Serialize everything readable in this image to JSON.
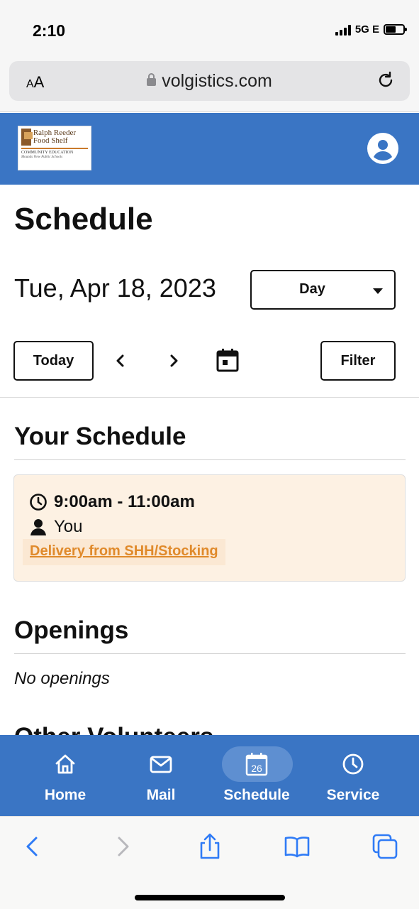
{
  "status_bar": {
    "time": "2:10",
    "network": "5G E",
    "battery_level": 0.6
  },
  "browser": {
    "text_size_small": "A",
    "text_size_large": "A",
    "url": "volgistics.com"
  },
  "header": {
    "logo_text": "Ralph Reeder Food Shelf",
    "logo_sub": "COMMUNITY EDUCATION",
    "logo_sub2": "Mounds View Public Schools"
  },
  "page": {
    "title": "Schedule",
    "date": "Tue, Apr 18, 2023",
    "view_select": "Day",
    "today_label": "Today",
    "filter_label": "Filter"
  },
  "your_schedule": {
    "title": "Your Schedule",
    "time": "9:00am - 11:00am",
    "who": "You",
    "task": "Delivery from SHH/Stocking"
  },
  "openings": {
    "title": "Openings",
    "empty_text": "No openings"
  },
  "other_volunteers": {
    "title": "Other Volunteers"
  },
  "bottom_nav": {
    "items": [
      {
        "label": "Home",
        "icon": "home-icon"
      },
      {
        "label": "Mail",
        "icon": "mail-icon"
      },
      {
        "label": "Schedule",
        "icon": "calendar-icon",
        "date_num": "26",
        "active": true
      },
      {
        "label": "Service",
        "icon": "clock-icon"
      }
    ]
  },
  "colors": {
    "brand_blue": "#3a75c4",
    "card_bg": "#fdf1e3",
    "link_orange": "#e08a2b"
  }
}
